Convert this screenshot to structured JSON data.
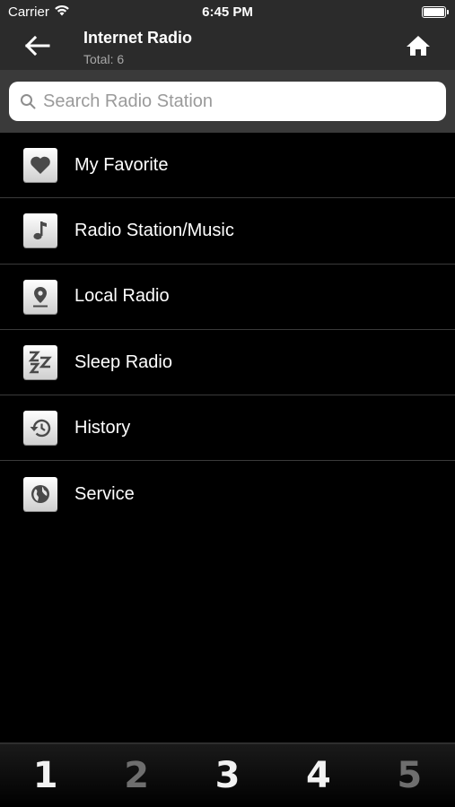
{
  "status_bar": {
    "carrier": "Carrier",
    "time": "6:45 PM"
  },
  "nav": {
    "title": "Internet Radio",
    "subtitle": "Total: 6"
  },
  "search": {
    "placeholder": "Search Radio Station",
    "value": ""
  },
  "menu": {
    "items": [
      {
        "label": "My Favorite",
        "icon": "heart-icon"
      },
      {
        "label": "Radio Station/Music",
        "icon": "music-note-icon"
      },
      {
        "label": "Local Radio",
        "icon": "location-pin-icon"
      },
      {
        "label": "Sleep Radio",
        "icon": "sleep-zzz-icon"
      },
      {
        "label": "History",
        "icon": "history-icon"
      },
      {
        "label": "Service",
        "icon": "globe-icon"
      }
    ]
  },
  "presets": [
    {
      "label": "1",
      "active": true
    },
    {
      "label": "2",
      "active": false
    },
    {
      "label": "3",
      "active": true
    },
    {
      "label": "4",
      "active": true
    },
    {
      "label": "5",
      "active": false
    }
  ],
  "colors": {
    "bar_bg": "#2b2b2b",
    "search_bg": "#3a3a3a",
    "preset_active": "#f2f2f2",
    "preset_inactive": "#6e6e6e"
  }
}
